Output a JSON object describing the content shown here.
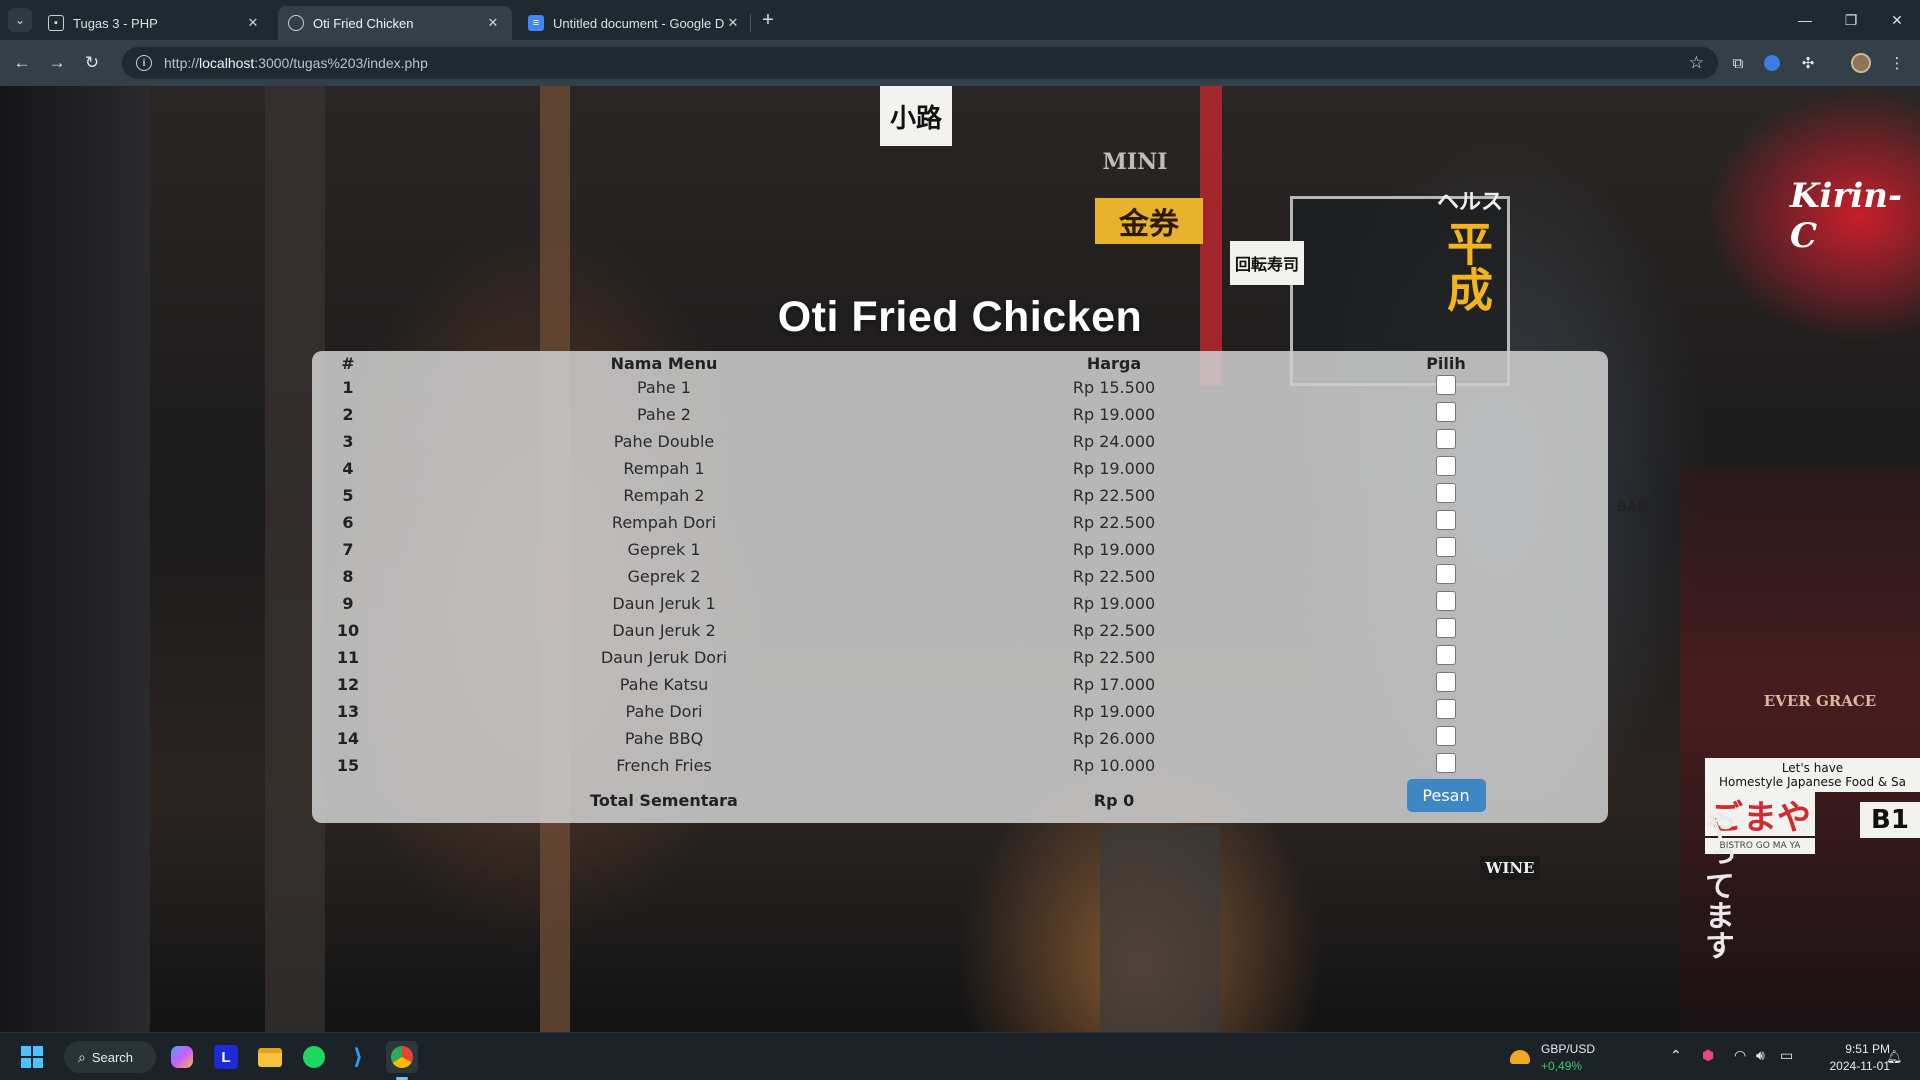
{
  "browser": {
    "tabs": [
      {
        "title": "Tugas 3 - PHP",
        "active": false
      },
      {
        "title": "Oti Fried Chicken",
        "active": true
      },
      {
        "title": "Untitled document - Google Do",
        "active": false
      }
    ],
    "url_prefix": "http://",
    "url_host": "localhost",
    "url_path": ":3000/tugas%203/index.php"
  },
  "page": {
    "title": "Oti Fried Chicken",
    "table": {
      "headers": {
        "no": "#",
        "name": "Nama Menu",
        "price": "Harga",
        "pick": "Pilih"
      },
      "rows": [
        {
          "no": "1",
          "name": "Pahe 1",
          "price": "Rp 15.500",
          "checked": false
        },
        {
          "no": "2",
          "name": "Pahe 2",
          "price": "Rp 19.000",
          "checked": false
        },
        {
          "no": "3",
          "name": "Pahe Double",
          "price": "Rp 24.000",
          "checked": false
        },
        {
          "no": "4",
          "name": "Rempah 1",
          "price": "Rp 19.000",
          "checked": false
        },
        {
          "no": "5",
          "name": "Rempah 2",
          "price": "Rp 22.500",
          "checked": false
        },
        {
          "no": "6",
          "name": "Rempah Dori",
          "price": "Rp 22.500",
          "checked": false
        },
        {
          "no": "7",
          "name": "Geprek 1",
          "price": "Rp 19.000",
          "checked": false
        },
        {
          "no": "8",
          "name": "Geprek 2",
          "price": "Rp 22.500",
          "checked": false
        },
        {
          "no": "9",
          "name": "Daun Jeruk 1",
          "price": "Rp 19.000",
          "checked": false
        },
        {
          "no": "10",
          "name": "Daun Jeruk 2",
          "price": "Rp 22.500",
          "checked": false
        },
        {
          "no": "11",
          "name": "Daun Jeruk Dori",
          "price": "Rp 22.500",
          "checked": false
        },
        {
          "no": "12",
          "name": "Pahe Katsu",
          "price": "Rp 17.000",
          "checked": false
        },
        {
          "no": "13",
          "name": "Pahe Dori",
          "price": "Rp 19.000",
          "checked": false
        },
        {
          "no": "14",
          "name": "Pahe BBQ",
          "price": "Rp 26.000",
          "checked": false
        },
        {
          "no": "15",
          "name": "French Fries",
          "price": "Rp 10.000",
          "checked": false
        }
      ],
      "total_label": "Total Sementara",
      "total_value": "Rp 0",
      "order_button": "Pesan"
    }
  },
  "background_signs": {
    "kanji_top": "小路",
    "mini": "MINI",
    "kinken": "金券",
    "heisei": "平成",
    "herusu": "ヘルス",
    "kaiten": "回転寿司",
    "kirin": "Kirin-C",
    "bar": "BAR",
    "ever_grace": "EVER GRACE",
    "homestyle_1": "Let's have",
    "homestyle_2": "Homestyle Japanese Food & Sa",
    "gomaya": "ごまや",
    "bistro": "BISTRO GO MA YA",
    "b1": "B1",
    "wine": "WINE",
    "yatte": "やってます"
  },
  "taskbar": {
    "search_label": "Search",
    "ticker_name": "GBP/USD",
    "ticker_change": "+0,49%",
    "time": "9:51 PM",
    "date": "2024-11-01"
  },
  "colors": {
    "order_button": "#3f86c4",
    "card_bg": "#cdcdcd",
    "chrome_dark": "#1f2a30",
    "chrome_toolbar": "#334047"
  }
}
